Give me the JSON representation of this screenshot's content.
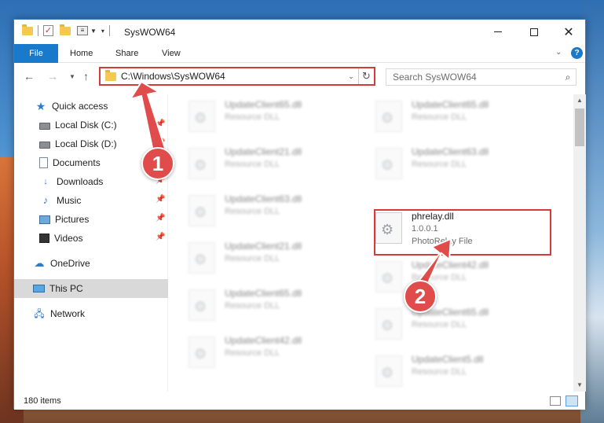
{
  "window": {
    "title": "SysWOW64"
  },
  "ribbon": {
    "tabs": [
      "File",
      "Home",
      "Share",
      "View"
    ]
  },
  "address": {
    "path": "C:\\Windows\\SysWOW64"
  },
  "search": {
    "placeholder": "Search SysWOW64"
  },
  "sidebar": {
    "items": [
      {
        "label": "Quick access",
        "icon": "star-icon",
        "pinned": false
      },
      {
        "label": "Local Disk (C:)",
        "icon": "drive-icon",
        "pinned": true
      },
      {
        "label": "Local Disk (D:)",
        "icon": "drive-icon",
        "pinned": true
      },
      {
        "label": "Documents",
        "icon": "document-icon",
        "pinned": true
      },
      {
        "label": "Downloads",
        "icon": "download-icon",
        "pinned": true
      },
      {
        "label": "Music",
        "icon": "music-icon",
        "pinned": true
      },
      {
        "label": "Pictures",
        "icon": "pictures-icon",
        "pinned": true
      },
      {
        "label": "Videos",
        "icon": "video-icon",
        "pinned": true
      },
      {
        "label": "OneDrive",
        "icon": "cloud-icon",
        "pinned": false
      },
      {
        "label": "This PC",
        "icon": "computer-icon",
        "pinned": false
      },
      {
        "label": "Network",
        "icon": "network-icon",
        "pinned": false
      }
    ],
    "selected": "This PC"
  },
  "files": [
    {
      "name": "UpdateClient65.dll",
      "line2": "Resource DLL",
      "line3": ""
    },
    {
      "name": "UpdateClient65.dll",
      "line2": "Resource DLL",
      "line3": ""
    },
    {
      "name": "UpdateClient21.dll",
      "line2": "Resource DLL",
      "line3": ""
    },
    {
      "name": "UpdateClient63.dll",
      "line2": "Resource DLL",
      "line3": ""
    },
    {
      "name": "UpdateClient63.dll",
      "line2": "Resource DLL",
      "line3": ""
    },
    {
      "name": "phrelay.dll",
      "line2": "1.0.0.1",
      "line3": "PhotoRelay File"
    },
    {
      "name": "UpdateClient21.dll",
      "line2": "Resource DLL",
      "line3": ""
    },
    {
      "name": "UpdateClient42.dll",
      "line2": "Resource DLL",
      "line3": ""
    },
    {
      "name": "UpdateClient65.dll",
      "line2": "Resource DLL",
      "line3": ""
    },
    {
      "name": "UpdateClient65.dll",
      "line2": "Resource DLL",
      "line3": ""
    },
    {
      "name": "UpdateClient42.dll",
      "line2": "Resource DLL",
      "line3": ""
    },
    {
      "name": "UpdateClient5.dll",
      "line2": "Resource DLL",
      "line3": ""
    }
  ],
  "status": {
    "item_count": "180 items"
  },
  "annotations": {
    "step1": "1",
    "step2": "2"
  },
  "colors": {
    "accent": "#1979ca",
    "highlight": "#d63b3b",
    "badge": "#e04b4b"
  }
}
